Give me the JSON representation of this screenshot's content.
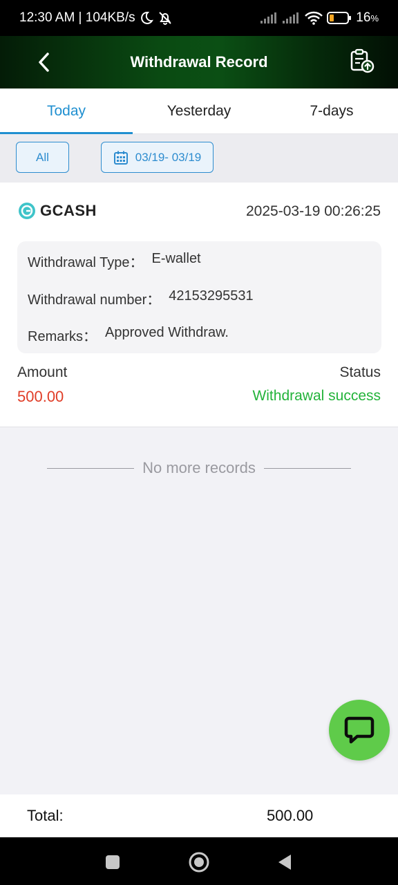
{
  "status_bar": {
    "time_speed": "12:30 AM | 104KB/s",
    "battery": "16"
  },
  "header": {
    "title": "Withdrawal Record"
  },
  "tabs": [
    {
      "label": "Today",
      "active": true
    },
    {
      "label": "Yesterday",
      "active": false
    },
    {
      "label": "7-days",
      "active": false
    }
  ],
  "filters": {
    "all_label": "All",
    "date_range": "03/19- 03/19"
  },
  "record": {
    "brand": "GCASH",
    "datetime": "2025-03-19 00:26:25",
    "type_label": "Withdrawal Type：",
    "type_value": "E-wallet",
    "number_label": "Withdrawal number：",
    "number_value": "42153295531",
    "remarks_label": "Remarks：",
    "remarks_value": "Approved Withdraw.",
    "amount_label": "Amount",
    "amount_value": "500.00",
    "status_label": "Status",
    "status_value": "Withdrawal success"
  },
  "list_end_text": "No more records",
  "total": {
    "label": "Total:",
    "value": "500.00"
  },
  "colors": {
    "accent": "#1f8fd0",
    "amount": "#e03d27",
    "success": "#23b33a",
    "fab": "#5fcb4a"
  }
}
